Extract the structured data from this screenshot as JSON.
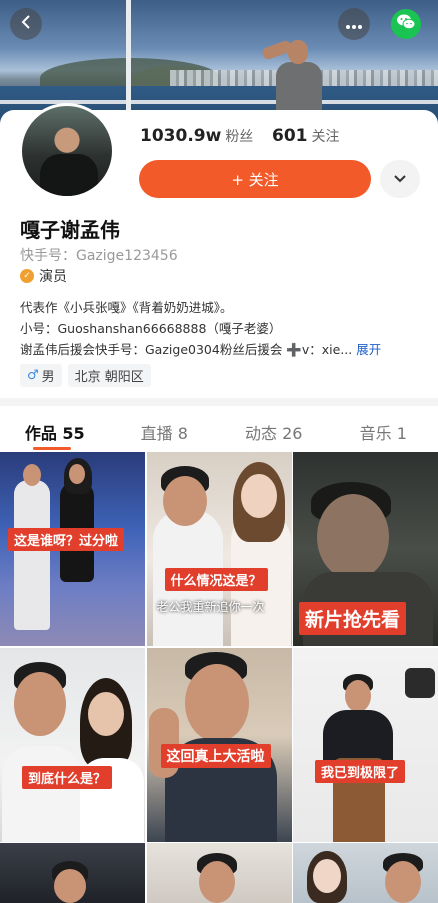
{
  "profile": {
    "fans_count": "1030.9w",
    "fans_label": "粉丝",
    "following_count": "601",
    "following_label": "关注",
    "follow_button": "+ 关注",
    "name": "嘎子谢孟伟",
    "kuaishou_id": "快手号：Gazige123456",
    "certification": "演员",
    "bio": [
      "代表作《小兵张嘎》《背着奶奶进城》。",
      "小号：Guoshanshan66668888（嘎子老婆）",
      "谢孟伟后援会快手号：Gazige0304粉丝后援会 ➕v：xie..."
    ],
    "expand_label": "展开",
    "gender": "男",
    "gender_icon": "♂",
    "location": "北京 朝阳区"
  },
  "tabs": [
    {
      "label": "作品 55",
      "active": true
    },
    {
      "label": "直播 8",
      "active": false
    },
    {
      "label": "动态 26",
      "active": false
    },
    {
      "label": "音乐 1",
      "active": false
    }
  ],
  "videos": [
    {
      "caption": "这是谁呀？过分啦"
    },
    {
      "caption": "什么情况这是？",
      "subtitle": "老公我重新追你一次"
    },
    {
      "caption": "新片抢先看"
    },
    {
      "caption": "到底什么是？"
    },
    {
      "caption": "这回真上大活啦"
    },
    {
      "caption": "我已到极限了"
    }
  ],
  "colors": {
    "accent": "#f25a2a",
    "caption_red": "#e23e2c",
    "link_blue": "#1f60c8",
    "wechat_green": "#19c453"
  },
  "icons": {
    "back": "back-chevron-icon",
    "more": "more-dots-icon",
    "share": "wechat-icon",
    "dropdown": "chevron-down-icon",
    "cert": "certification-icon",
    "gender": "male-icon"
  }
}
